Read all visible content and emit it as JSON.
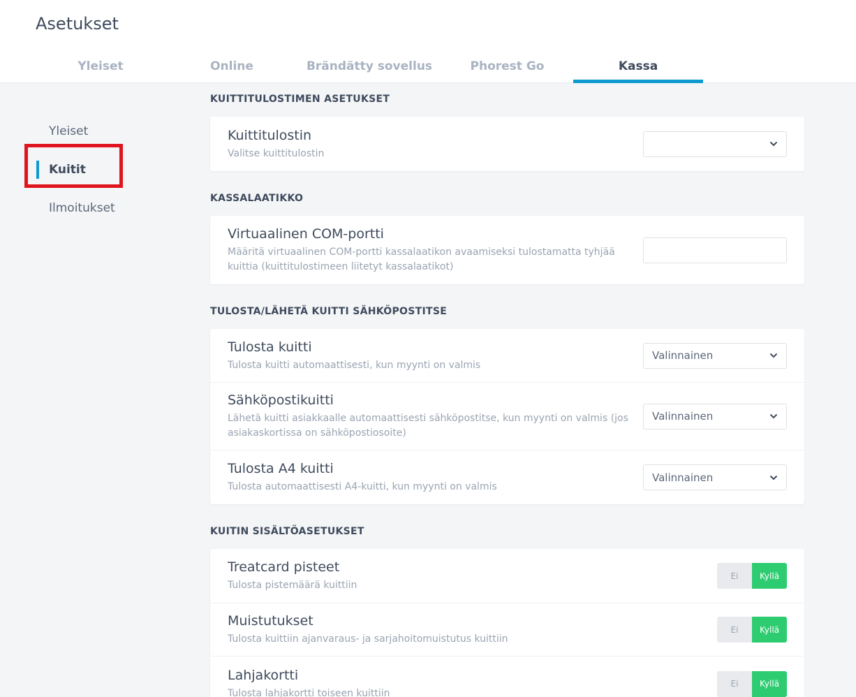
{
  "header": {
    "title": "Asetukset",
    "tabs": [
      {
        "label": "Yleiset"
      },
      {
        "label": "Online"
      },
      {
        "label": "Brändätty sovellus"
      },
      {
        "label": "Phorest Go"
      },
      {
        "label": "Kassa"
      }
    ],
    "active_tab": "Kassa"
  },
  "sidebar": {
    "items": [
      {
        "label": "Yleiset"
      },
      {
        "label": "Kuitit"
      },
      {
        "label": "Ilmoitukset"
      }
    ],
    "active_item": "Kuitit"
  },
  "sections": {
    "printer": {
      "title": "KUITTITULOSTIMEN ASETUKSET",
      "rows": [
        {
          "title": "Kuittitulostin",
          "desc": "Valitse kuittitulostin",
          "value": ""
        }
      ]
    },
    "drawer": {
      "title": "KASSALAATIKKO",
      "rows": [
        {
          "title": "Virtuaalinen COM-portti",
          "desc": "Määritä virtuaalinen COM-portti kassalaatikon avaamiseksi tulostamatta tyhjää kuittia (kuittitulostimeen liitetyt kassalaatikot)",
          "value": ""
        }
      ]
    },
    "print_email": {
      "title": "TULOSTA/LÄHETÄ KUITTI SÄHKÖPOSTITSE",
      "rows": [
        {
          "title": "Tulosta kuitti",
          "desc": "Tulosta kuitti automaattisesti, kun myynti on valmis",
          "value": "Valinnainen"
        },
        {
          "title": "Sähköpostikuitti",
          "desc": "Lähetä kuitti asiakkaalle automaattisesti sähköpostitse, kun myynti on valmis (jos asiakaskortissa on sähköpostiosoite)",
          "value": "Valinnainen"
        },
        {
          "title": "Tulosta A4 kuitti",
          "desc": "Tulosta automaattisesti A4-kuitti, kun myynti on valmis",
          "value": "Valinnainen"
        }
      ]
    },
    "content": {
      "title": "KUITIN SISÄLTÖASETUKSET",
      "toggle_off": "Ei",
      "toggle_on": "Kyllä",
      "rows": [
        {
          "title": "Treatcard pisteet",
          "desc": "Tulosta pistemäärä kuittiin",
          "selected": "Kyllä"
        },
        {
          "title": "Muistutukset",
          "desc": "Tulosta kuittiin ajanvaraus- ja sarjahoitomuistutus kuittiin",
          "selected": "Kyllä"
        },
        {
          "title": "Lahjakortti",
          "desc": "Tulosta lahjakortti toiseen kuittiin",
          "selected": "Kyllä"
        }
      ]
    }
  },
  "colors": {
    "accent": "#0e99d0",
    "toggle_on": "#2ecc71",
    "highlight": "#e0141e"
  }
}
